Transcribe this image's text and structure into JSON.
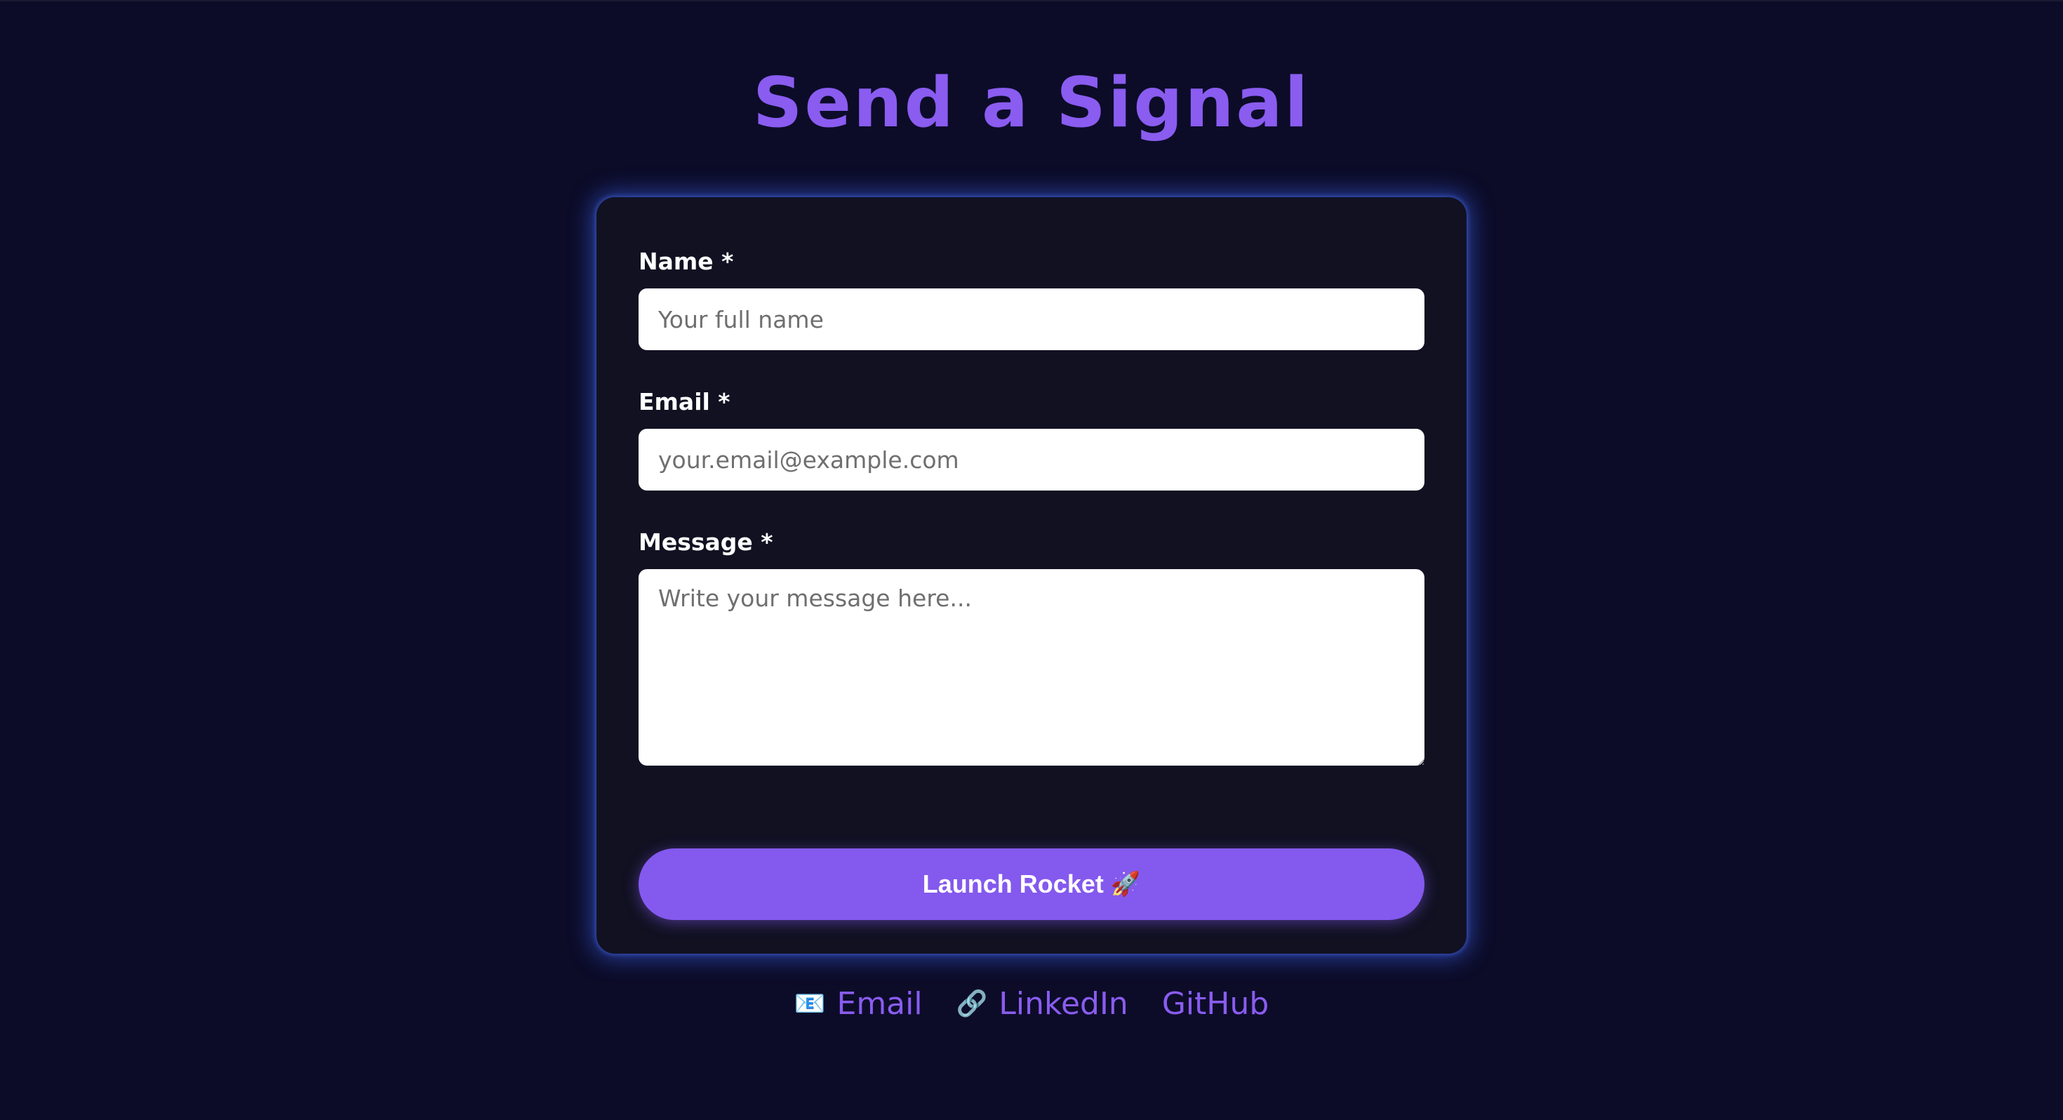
{
  "page": {
    "title": "Send a Signal",
    "accent_color": "#8459ee",
    "background_color": "#0c0c29"
  },
  "form": {
    "name": {
      "label": "Name *",
      "placeholder": "Your full name",
      "value": ""
    },
    "email": {
      "label": "Email *",
      "placeholder": "your.email@example.com",
      "value": ""
    },
    "message": {
      "label": "Message *",
      "placeholder": "Write your message here...",
      "value": ""
    },
    "submit": {
      "label": "Launch Rocket",
      "icon": "rocket-icon",
      "icon_glyph": "🚀"
    }
  },
  "footer": {
    "links": [
      {
        "label": "Email",
        "icon": "envelope-icon",
        "icon_glyph": "📧"
      },
      {
        "label": "LinkedIn",
        "icon": "link-icon",
        "icon_glyph": "🔗"
      },
      {
        "label": "GitHub"
      }
    ]
  }
}
